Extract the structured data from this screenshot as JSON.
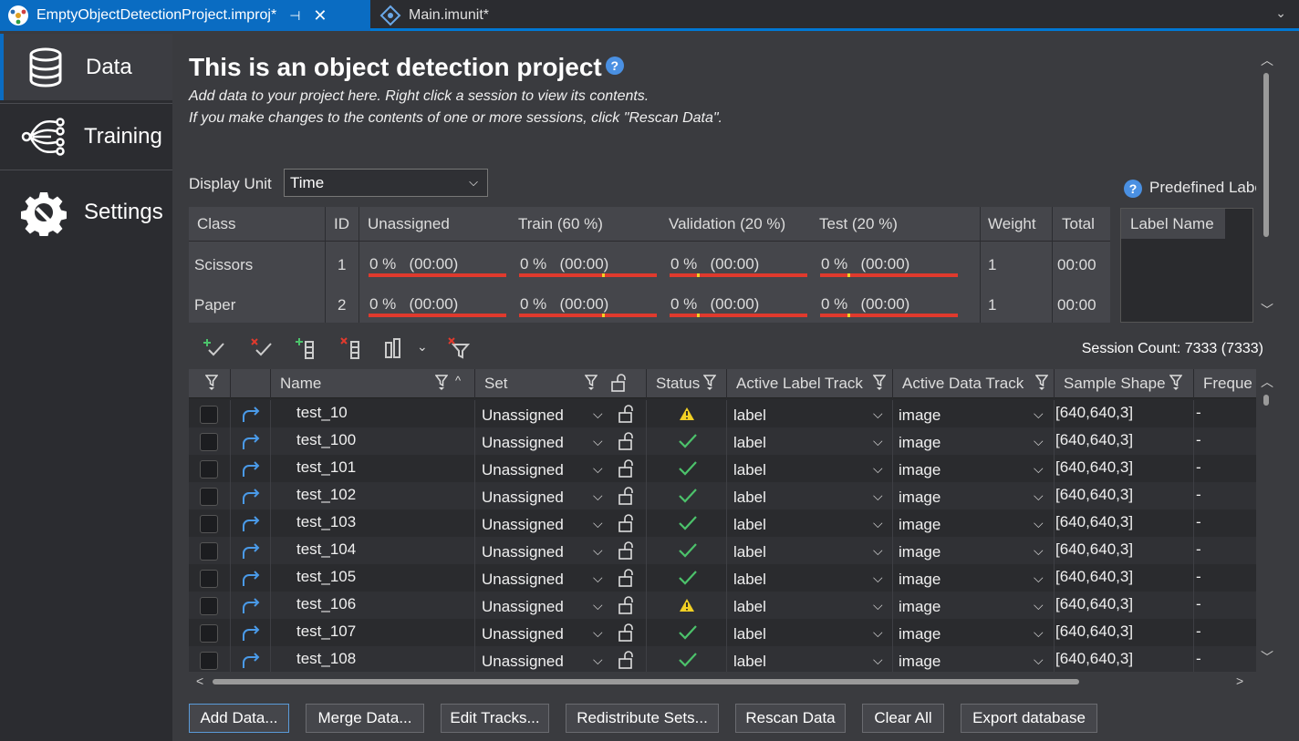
{
  "tabs": [
    {
      "label": "EmptyObjectDetectionProject.improj*",
      "active": true
    },
    {
      "label": "Main.imunit*",
      "active": false
    }
  ],
  "sidebar": {
    "items": [
      {
        "label": "Data",
        "icon": "database-icon"
      },
      {
        "label": "Training",
        "icon": "neural-network-icon"
      },
      {
        "label": "Settings",
        "icon": "gear-wrench-icon"
      }
    ]
  },
  "header": {
    "title": "This is an object detection project",
    "desc1": "Add data to your project here. Right click a session to view its contents.",
    "desc2": "If you make changes to the contents of one or more sessions, click \"Rescan Data\"."
  },
  "display_unit": {
    "label": "Display Unit",
    "value": "Time"
  },
  "class_table": {
    "headers": [
      "Class",
      "ID",
      "Unassigned",
      "Train (60 %)",
      "Validation (20 %)",
      "Test (20 %)",
      "Weight",
      "Total"
    ],
    "rows": [
      {
        "class": "Scissors",
        "id": "1",
        "unassigned": "0 %   (00:00)",
        "train": "0 %   (00:00)",
        "validation": "0 %   (00:00)",
        "test": "0 %   (00:00)",
        "weight": "1",
        "total": "00:00"
      },
      {
        "class": "Paper",
        "id": "2",
        "unassigned": "0 %   (00:00)",
        "train": "0 %   (00:00)",
        "validation": "0 %   (00:00)",
        "test": "0 %   (00:00)",
        "weight": "1",
        "total": "00:00"
      }
    ]
  },
  "predefined": {
    "title": "Predefined Labels",
    "header": "Label Name"
  },
  "toolbar": {
    "session_count": "Session Count: 7333 (7333)"
  },
  "grid": {
    "headers": {
      "name": "Name",
      "set": "Set",
      "status": "Status",
      "label_track": "Active Label Track",
      "data_track": "Active Data Track",
      "shape": "Sample Shape",
      "freq": "Freque"
    },
    "rows": [
      {
        "name": "test_10",
        "set": "Unassigned",
        "status": "warning",
        "label": "label",
        "data": "image",
        "shape": "[640,640,3]",
        "freq": "-"
      },
      {
        "name": "test_100",
        "set": "Unassigned",
        "status": "ok",
        "label": "label",
        "data": "image",
        "shape": "[640,640,3]",
        "freq": "-"
      },
      {
        "name": "test_101",
        "set": "Unassigned",
        "status": "ok",
        "label": "label",
        "data": "image",
        "shape": "[640,640,3]",
        "freq": "-"
      },
      {
        "name": "test_102",
        "set": "Unassigned",
        "status": "ok",
        "label": "label",
        "data": "image",
        "shape": "[640,640,3]",
        "freq": "-"
      },
      {
        "name": "test_103",
        "set": "Unassigned",
        "status": "ok",
        "label": "label",
        "data": "image",
        "shape": "[640,640,3]",
        "freq": "-"
      },
      {
        "name": "test_104",
        "set": "Unassigned",
        "status": "ok",
        "label": "label",
        "data": "image",
        "shape": "[640,640,3]",
        "freq": "-"
      },
      {
        "name": "test_105",
        "set": "Unassigned",
        "status": "ok",
        "label": "label",
        "data": "image",
        "shape": "[640,640,3]",
        "freq": "-"
      },
      {
        "name": "test_106",
        "set": "Unassigned",
        "status": "warning",
        "label": "label",
        "data": "image",
        "shape": "[640,640,3]",
        "freq": "-"
      },
      {
        "name": "test_107",
        "set": "Unassigned",
        "status": "ok",
        "label": "label",
        "data": "image",
        "shape": "[640,640,3]",
        "freq": "-"
      },
      {
        "name": "test_108",
        "set": "Unassigned",
        "status": "ok",
        "label": "label",
        "data": "image",
        "shape": "[640,640,3]",
        "freq": "-"
      }
    ]
  },
  "buttons": {
    "add": "Add Data...",
    "merge": "Merge Data...",
    "edit": "Edit Tracks...",
    "redistribute": "Redistribute Sets...",
    "rescan": "Rescan Data",
    "clear": "Clear All",
    "export": "Export database"
  },
  "colors": {
    "accent": "#0a6cc2",
    "bar_red": "#e03a2d",
    "bar_mark": "#f2d024",
    "ok_green": "#4cc26b",
    "warn_yellow": "#f2d024"
  }
}
